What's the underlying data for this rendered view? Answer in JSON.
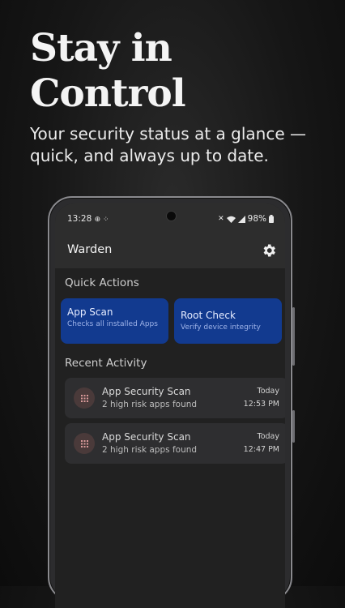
{
  "promo": {
    "headline_line1": "Stay in",
    "headline_line2": "Control",
    "subline": "Your security status at a glance — quick, and always up to date."
  },
  "status_bar": {
    "time": "13:28",
    "battery": "98%"
  },
  "app": {
    "title": "Warden",
    "settings_icon": "gear-icon"
  },
  "quick_actions": {
    "title": "Quick Actions",
    "items": [
      {
        "title": "App Scan",
        "subtitle": "Checks all installed Apps"
      },
      {
        "title": "Root Check",
        "subtitle": "Verify device integrity"
      }
    ]
  },
  "recent_activity": {
    "title": "Recent Activity",
    "items": [
      {
        "title": "App Security Scan",
        "subtitle": "2 high risk apps found",
        "date": "Today",
        "time": "12:53 PM",
        "icon": "grid-icon"
      },
      {
        "title": "App Security Scan",
        "subtitle": "2 high risk apps found",
        "date": "Today",
        "time": "12:47 PM",
        "icon": "grid-icon"
      }
    ]
  },
  "colors": {
    "card_accent": "#123a8f",
    "activity_icon_bg": "#4a3a3a",
    "activity_icon_fg": "#d99a9a"
  }
}
